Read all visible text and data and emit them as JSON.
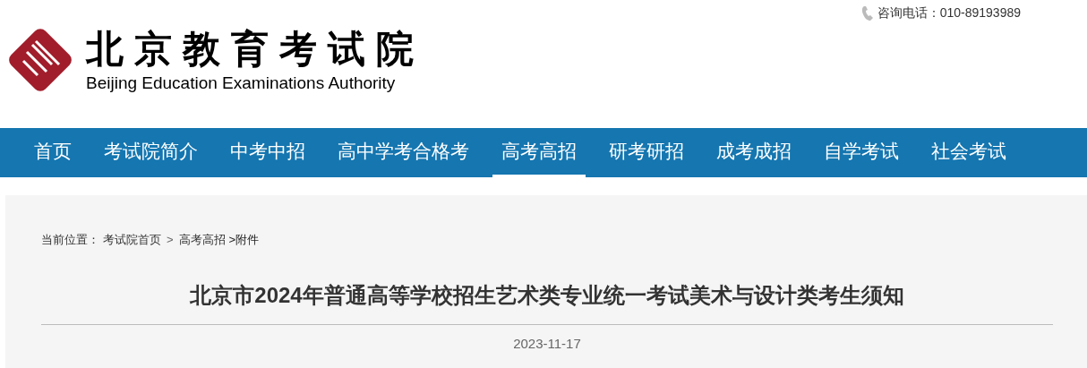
{
  "header": {
    "hotline": "咨询电话：010-89193989",
    "logo_cn": "北京教育考试院",
    "logo_en": "Beijing Education Examinations Authority"
  },
  "nav": [
    {
      "label": "首页",
      "selected": false
    },
    {
      "label": "考试院简介",
      "selected": false
    },
    {
      "label": "中考中招",
      "selected": false
    },
    {
      "label": "高中学考合格考",
      "selected": false
    },
    {
      "label": "高考高招",
      "selected": true
    },
    {
      "label": "研考研招",
      "selected": false
    },
    {
      "label": "成考成招",
      "selected": false
    },
    {
      "label": "自学考试",
      "selected": false
    },
    {
      "label": "社会考试",
      "selected": false
    }
  ],
  "breadcrumb": {
    "label": "当前位置：",
    "items": [
      {
        "kind": "link",
        "text": "考试院首页"
      },
      {
        "kind": "sep",
        "text": ">"
      },
      {
        "kind": "link",
        "text": "高考高招"
      },
      {
        "kind": "current",
        "text": ">附件"
      }
    ]
  },
  "article": {
    "title": "北京市2024年普通高等学校招生艺术类专业统一考试美术与设计类考生须知",
    "date": "2023-11-17"
  }
}
